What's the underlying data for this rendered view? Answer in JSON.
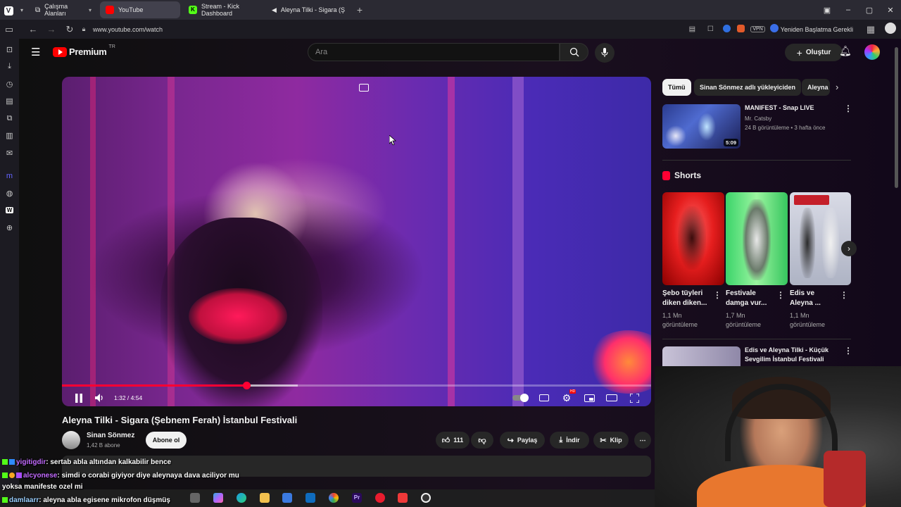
{
  "browser": {
    "tabs": [
      {
        "label": "Çalışma Alanları"
      },
      {
        "label": "YouTube"
      },
      {
        "label": "Stream - Kick Dashboard"
      },
      {
        "label": "Aleyna Tilki - Sigara (Şebne"
      }
    ],
    "new_tab": "+",
    "url": "www.youtube.com/watch",
    "vpn": "VPN",
    "restart_label": "Yeniden Başlatma Gerekli"
  },
  "youtube": {
    "brand": "Premium",
    "brand_suffix": "TR",
    "search_placeholder": "Ara",
    "create_label": "Oluştur",
    "video": {
      "time": "1:32 / 4:54",
      "progress_fraction": 0.3129,
      "buffered_fraction": 0.4,
      "settings_badge": "HD",
      "title": "Aleyna Tilki - Sigara (Şebnem Ferah) İstanbul Festivali",
      "channel": "Sinan Sönmez",
      "subscribers": "1,42 B abone",
      "subscribe_label": "Abone ol",
      "likes": "111",
      "share_label": "Paylaş",
      "download_label": "İndir",
      "clip_label": "Klip"
    },
    "chips": [
      "Tümü",
      "Sinan Sönmez adlı yükleyiciden",
      "Aleyna"
    ],
    "related_top": {
      "title": "MANIFEST - Snap LIVE",
      "channel": "Mr. Catsby",
      "meta": "24 B görüntüleme • 3 hafta önce",
      "duration": "5:09"
    },
    "shorts_heading": "Shorts",
    "shorts": [
      {
        "title1": "Şebo tüyleri",
        "title2": "diken diken...",
        "views": "1,1 Mn",
        "views_label": "görüntüleme"
      },
      {
        "title1": "Festivale",
        "title2": "damga vur...",
        "views": "1,7 Mn",
        "views_label": "görüntüleme"
      },
      {
        "title1": "Edis ve",
        "title2": "Aleyna ...",
        "views": "1,1 Mn",
        "views_label": "görüntüleme"
      }
    ],
    "related_bottom": {
      "title1": "Edis ve Aleyna Tilki - Küçük",
      "title2": "Sevgilim İstanbul Festivali"
    }
  },
  "chat": [
    {
      "user": "yigitigdir",
      "text": ": sertab abla altından kalkabilir bence"
    },
    {
      "user": "alcyonese",
      "text": ": simdi o corabi giyiyor diye aleynaya dava aciliyor mu"
    },
    {
      "user": "",
      "text": "yoksa manifeste ozel mi"
    },
    {
      "user": "damlaarr",
      "text": ": aleyna abla egisene mikrofon düşmüş"
    }
  ],
  "colors": {
    "accent_red": "#ff0033",
    "kick_green": "#53fc18",
    "chat_user": "#c36bff"
  }
}
